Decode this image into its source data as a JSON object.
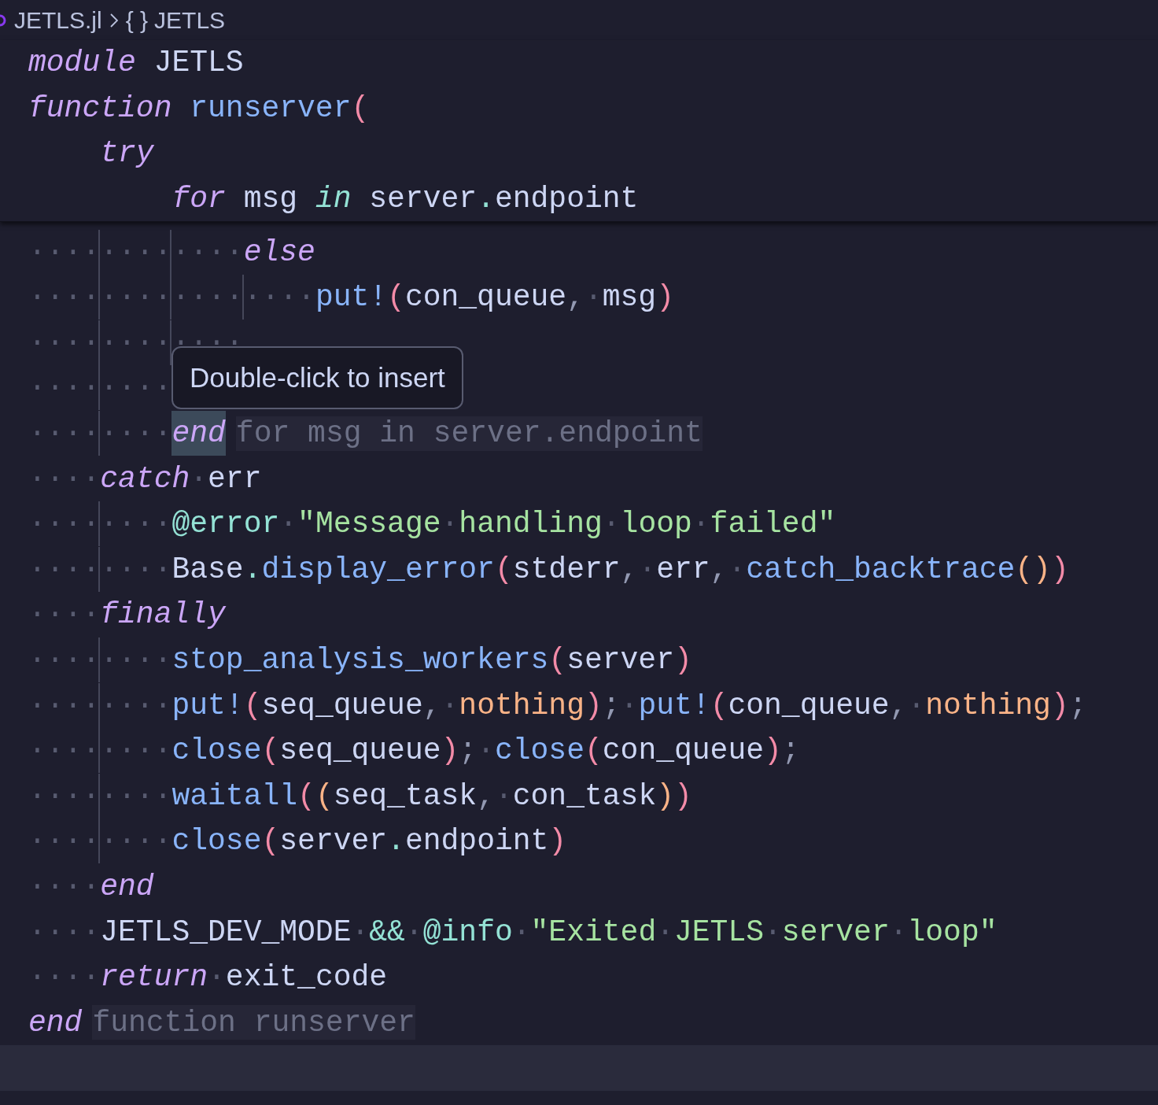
{
  "breadcrumb": {
    "file": "JETLS.jl",
    "symbol_icon": "{ }",
    "symbol": "JETLS"
  },
  "sticky_lines": [
    {
      "tokens": [
        {
          "kind": "keyword",
          "text": "module "
        },
        {
          "kind": "plain",
          "text": "JETLS"
        }
      ]
    },
    {
      "tokens": [
        {
          "kind": "keyword",
          "text": "function "
        },
        {
          "kind": "fn",
          "text": "runserver"
        },
        {
          "kind": "paren",
          "text": "("
        }
      ]
    },
    {
      "tokens": [
        {
          "kind": "keyword",
          "text": "    try"
        }
      ]
    },
    {
      "tokens": [
        {
          "kind": "keyword",
          "text": "        for "
        },
        {
          "kind": "plain",
          "text": "msg "
        },
        {
          "kind": "operator_kw",
          "text": "in "
        },
        {
          "kind": "plain",
          "text": "server"
        },
        {
          "kind": "dot",
          "text": "."
        },
        {
          "kind": "plain",
          "text": "endpoint"
        }
      ]
    }
  ],
  "lines": [
    {
      "current": false,
      "tokens": [
        {
          "kind": "indent",
          "text": "············"
        },
        {
          "kind": "keyword",
          "text": "else"
        }
      ]
    },
    {
      "current": false,
      "tokens": [
        {
          "kind": "indent",
          "text": "················"
        },
        {
          "kind": "fn",
          "text": "put!"
        },
        {
          "kind": "paren",
          "text": "("
        },
        {
          "kind": "plain",
          "text": "con_queue"
        },
        {
          "kind": "punct",
          "text": ","
        },
        {
          "kind": "space",
          "text": "·"
        },
        {
          "kind": "plain",
          "text": "msg"
        },
        {
          "kind": "paren",
          "text": ")"
        }
      ]
    },
    {
      "current": false,
      "tokens": [
        {
          "kind": "indent",
          "text": "············"
        }
      ]
    },
    {
      "current": false,
      "tokens": [
        {
          "kind": "indent",
          "text": "········"
        }
      ]
    },
    {
      "current": false,
      "tokens": [
        {
          "kind": "indent",
          "text": "········"
        },
        {
          "kind": "match",
          "text": "end"
        }
      ],
      "hint": "for msg in server.endpoint"
    },
    {
      "current": false,
      "tokens": [
        {
          "kind": "indent",
          "text": "····"
        },
        {
          "kind": "keyword",
          "text": "catch"
        },
        {
          "kind": "space",
          "text": "·"
        },
        {
          "kind": "plain",
          "text": "err"
        }
      ]
    },
    {
      "current": false,
      "tokens": [
        {
          "kind": "indent",
          "text": "········"
        },
        {
          "kind": "macro",
          "text": "@error"
        },
        {
          "kind": "space",
          "text": "·"
        },
        {
          "kind": "string",
          "text": "\"Message"
        },
        {
          "kind": "space",
          "text": "·"
        },
        {
          "kind": "string",
          "text": "handling"
        },
        {
          "kind": "space",
          "text": "·"
        },
        {
          "kind": "string",
          "text": "loop"
        },
        {
          "kind": "space",
          "text": "·"
        },
        {
          "kind": "string",
          "text": "failed\""
        }
      ]
    },
    {
      "current": false,
      "tokens": [
        {
          "kind": "indent",
          "text": "········"
        },
        {
          "kind": "plain",
          "text": "Base"
        },
        {
          "kind": "dot",
          "text": "."
        },
        {
          "kind": "fn",
          "text": "display_error"
        },
        {
          "kind": "paren",
          "text": "("
        },
        {
          "kind": "plain",
          "text": "stderr"
        },
        {
          "kind": "punct",
          "text": ","
        },
        {
          "kind": "space",
          "text": "·"
        },
        {
          "kind": "plain",
          "text": "err"
        },
        {
          "kind": "punct",
          "text": ","
        },
        {
          "kind": "space",
          "text": "·"
        },
        {
          "kind": "fn",
          "text": "catch_backtrace"
        },
        {
          "kind": "paren2",
          "text": "()"
        },
        {
          "kind": "paren",
          "text": ")"
        }
      ]
    },
    {
      "current": false,
      "tokens": [
        {
          "kind": "indent",
          "text": "····"
        },
        {
          "kind": "keyword",
          "text": "finally"
        }
      ]
    },
    {
      "current": false,
      "tokens": [
        {
          "kind": "indent",
          "text": "········"
        },
        {
          "kind": "fn",
          "text": "stop_analysis_workers"
        },
        {
          "kind": "paren",
          "text": "("
        },
        {
          "kind": "plain",
          "text": "server"
        },
        {
          "kind": "paren",
          "text": ")"
        }
      ]
    },
    {
      "current": false,
      "tokens": [
        {
          "kind": "indent",
          "text": "········"
        },
        {
          "kind": "fn",
          "text": "put!"
        },
        {
          "kind": "paren",
          "text": "("
        },
        {
          "kind": "plain",
          "text": "seq_queue"
        },
        {
          "kind": "punct",
          "text": ","
        },
        {
          "kind": "space",
          "text": "·"
        },
        {
          "kind": "constant",
          "text": "nothing"
        },
        {
          "kind": "paren",
          "text": ")"
        },
        {
          "kind": "punct",
          "text": ";"
        },
        {
          "kind": "space",
          "text": "·"
        },
        {
          "kind": "fn",
          "text": "put!"
        },
        {
          "kind": "paren",
          "text": "("
        },
        {
          "kind": "plain",
          "text": "con_queue"
        },
        {
          "kind": "punct",
          "text": ","
        },
        {
          "kind": "space",
          "text": "·"
        },
        {
          "kind": "constant",
          "text": "nothing"
        },
        {
          "kind": "paren",
          "text": ")"
        },
        {
          "kind": "punct",
          "text": ";"
        }
      ]
    },
    {
      "current": false,
      "tokens": [
        {
          "kind": "indent",
          "text": "········"
        },
        {
          "kind": "fn",
          "text": "close"
        },
        {
          "kind": "paren",
          "text": "("
        },
        {
          "kind": "plain",
          "text": "seq_queue"
        },
        {
          "kind": "paren",
          "text": ")"
        },
        {
          "kind": "punct",
          "text": ";"
        },
        {
          "kind": "space",
          "text": "·"
        },
        {
          "kind": "fn",
          "text": "close"
        },
        {
          "kind": "paren",
          "text": "("
        },
        {
          "kind": "plain",
          "text": "con_queue"
        },
        {
          "kind": "paren",
          "text": ")"
        },
        {
          "kind": "punct",
          "text": ";"
        }
      ]
    },
    {
      "current": false,
      "tokens": [
        {
          "kind": "indent",
          "text": "········"
        },
        {
          "kind": "fn",
          "text": "waitall"
        },
        {
          "kind": "paren",
          "text": "("
        },
        {
          "kind": "paren2",
          "text": "("
        },
        {
          "kind": "plain",
          "text": "seq_task"
        },
        {
          "kind": "punct",
          "text": ","
        },
        {
          "kind": "space",
          "text": "·"
        },
        {
          "kind": "plain",
          "text": "con_task"
        },
        {
          "kind": "paren2",
          "text": ")"
        },
        {
          "kind": "paren",
          "text": ")"
        }
      ]
    },
    {
      "current": false,
      "tokens": [
        {
          "kind": "indent",
          "text": "········"
        },
        {
          "kind": "fn",
          "text": "close"
        },
        {
          "kind": "paren",
          "text": "("
        },
        {
          "kind": "plain",
          "text": "server"
        },
        {
          "kind": "dot",
          "text": "."
        },
        {
          "kind": "plain",
          "text": "endpoint"
        },
        {
          "kind": "paren",
          "text": ")"
        }
      ]
    },
    {
      "current": false,
      "tokens": [
        {
          "kind": "indent",
          "text": "····"
        },
        {
          "kind": "keyword",
          "text": "end"
        }
      ]
    },
    {
      "current": false,
      "tokens": [
        {
          "kind": "indent",
          "text": "····"
        },
        {
          "kind": "plain",
          "text": "JETLS_DEV_MODE"
        },
        {
          "kind": "space",
          "text": "·"
        },
        {
          "kind": "operator",
          "text": "&&"
        },
        {
          "kind": "space",
          "text": "·"
        },
        {
          "kind": "macro",
          "text": "@info"
        },
        {
          "kind": "space",
          "text": "·"
        },
        {
          "kind": "string",
          "text": "\"Exited"
        },
        {
          "kind": "space",
          "text": "·"
        },
        {
          "kind": "string",
          "text": "JETLS"
        },
        {
          "kind": "space",
          "text": "·"
        },
        {
          "kind": "string",
          "text": "server"
        },
        {
          "kind": "space",
          "text": "·"
        },
        {
          "kind": "string",
          "text": "loop\""
        }
      ]
    },
    {
      "current": false,
      "tokens": [
        {
          "kind": "indent",
          "text": "····"
        },
        {
          "kind": "keyword",
          "text": "return"
        },
        {
          "kind": "space",
          "text": "·"
        },
        {
          "kind": "plain",
          "text": "exit_code"
        }
      ]
    },
    {
      "current": false,
      "tokens": [
        {
          "kind": "keyword",
          "text": "end"
        }
      ],
      "hint": "function runserver"
    },
    {
      "current": true
    }
  ],
  "tooltip": {
    "text": "Double-click to insert"
  }
}
